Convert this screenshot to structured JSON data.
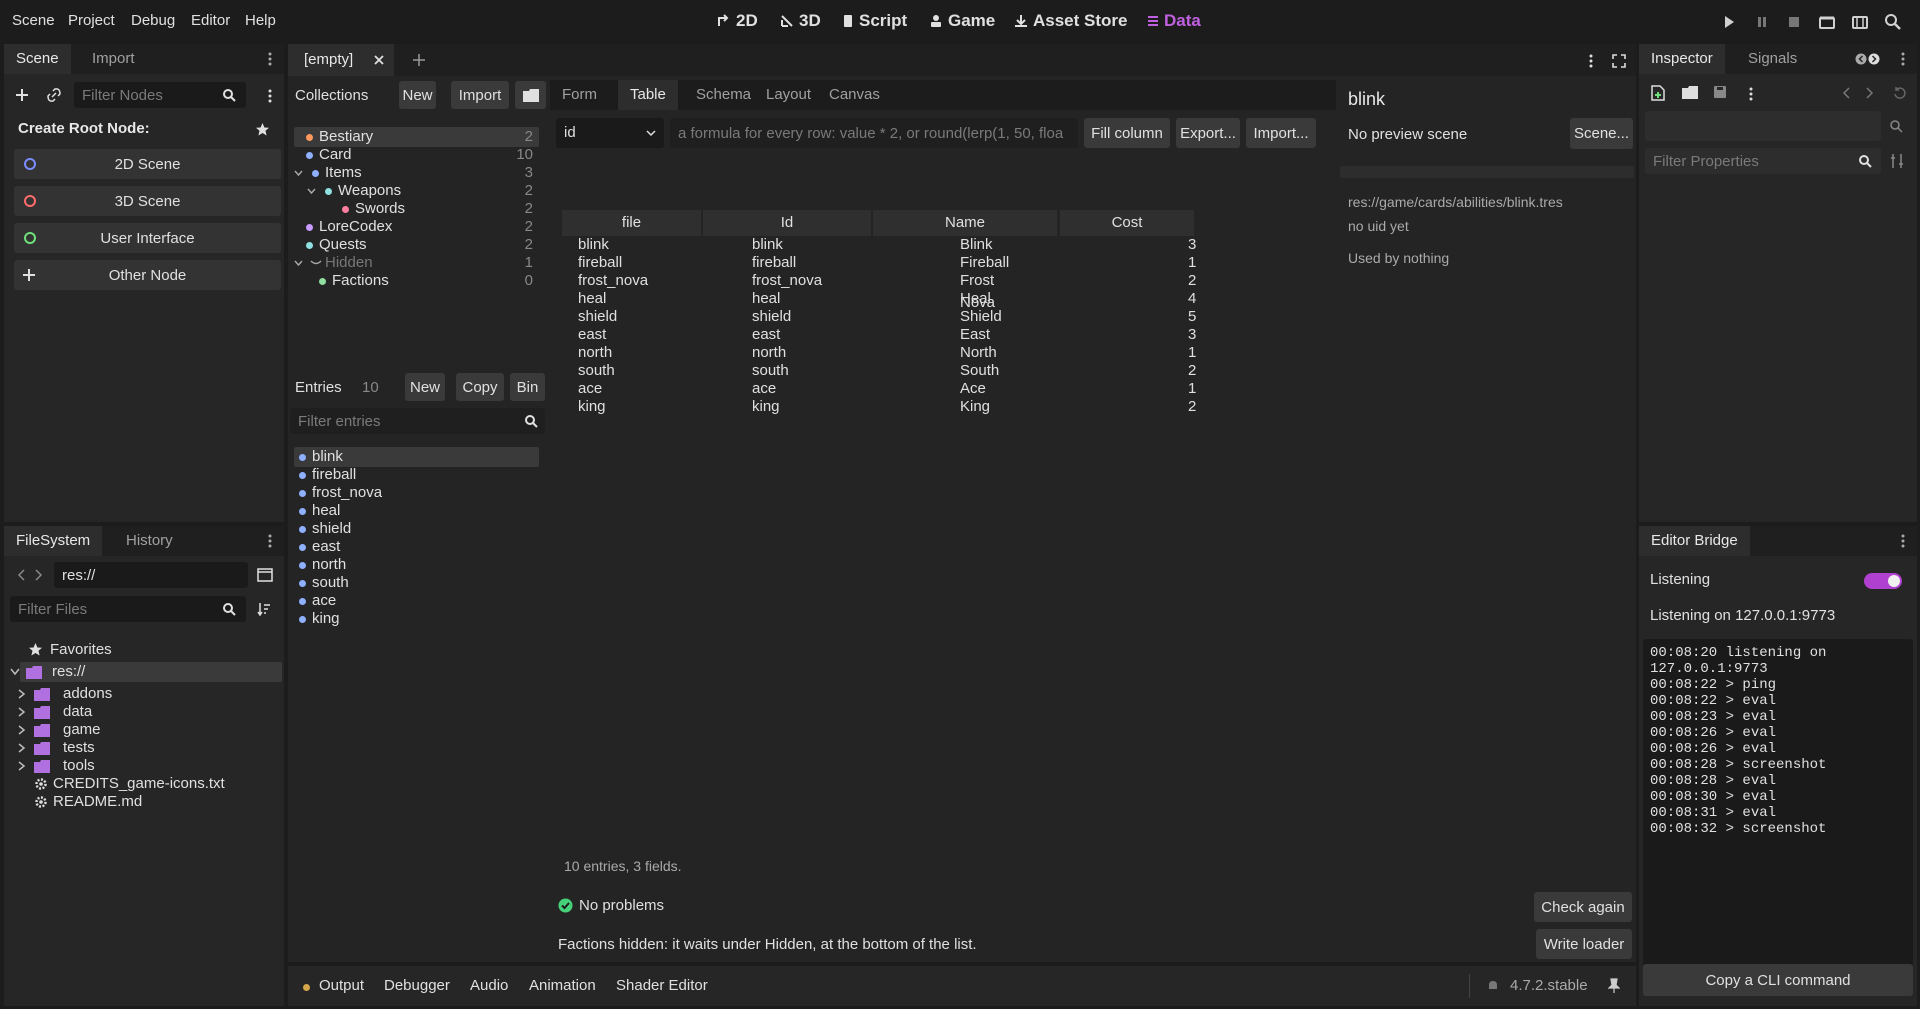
{
  "menu": [
    "Scene",
    "Project",
    "Debug",
    "Editor",
    "Help"
  ],
  "workspaces": [
    {
      "label": "2D",
      "icon": "2d-icon"
    },
    {
      "label": "3D",
      "icon": "3d-icon"
    },
    {
      "label": "Script",
      "icon": "script-icon"
    },
    {
      "label": "Game",
      "icon": "game-icon"
    },
    {
      "label": "Asset Store",
      "icon": "download-icon"
    },
    {
      "label": "Data",
      "icon": "list-icon",
      "active": true
    }
  ],
  "accent": "#c060e0",
  "scene_dock": {
    "tabs": [
      "Scene",
      "Import"
    ],
    "filter_placeholder": "Filter Nodes",
    "create_root_label": "Create Root Node:",
    "buttons": [
      {
        "label": "2D Scene",
        "color": "#7a8cff"
      },
      {
        "label": "3D Scene",
        "color": "#ff6b6b"
      },
      {
        "label": "User Interface",
        "color": "#6ee07a"
      },
      {
        "label": "Other Node",
        "color": "#e0e0e0"
      }
    ]
  },
  "filesystem": {
    "tabs": [
      "FileSystem",
      "History"
    ],
    "path": "res://",
    "filter_placeholder": "Filter Files",
    "favorites": "Favorites",
    "root": "res://",
    "folders": [
      "addons",
      "data",
      "game",
      "tests",
      "tools"
    ],
    "files": [
      "CREDITS_game-icons.txt",
      "README.md"
    ]
  },
  "editor_tab": {
    "label": "[empty]"
  },
  "collections": {
    "label": "Collections",
    "new": "New",
    "import": "Import",
    "items": [
      {
        "name": "Bestiary",
        "count": "2",
        "color": "#ff9a5c",
        "indent": 0,
        "selected": true
      },
      {
        "name": "Card",
        "count": "10",
        "color": "#8fb0ff",
        "indent": 0
      },
      {
        "name": "Items",
        "count": "3",
        "color": "#8fb0ff",
        "indent": 0,
        "expander": true
      },
      {
        "name": "Weapons",
        "count": "2",
        "color": "#8fe0e0",
        "indent": 1,
        "expander": true
      },
      {
        "name": "Swords",
        "count": "2",
        "color": "#ff7fa0",
        "indent": 2
      },
      {
        "name": "LoreCodex",
        "count": "2",
        "color": "#c79bff",
        "indent": 0
      },
      {
        "name": "Quests",
        "count": "2",
        "color": "#8fe0e0",
        "indent": 0
      },
      {
        "name": "Hidden",
        "count": "1",
        "color": "#888888",
        "indent": 0,
        "expander": true,
        "dim": true
      },
      {
        "name": "Factions",
        "count": "0",
        "color": "#8fe0a0",
        "indent": 1
      }
    ]
  },
  "entries": {
    "label": "Entries",
    "count": "10",
    "new": "New",
    "copy": "Copy",
    "bin": "Bin",
    "filter_placeholder": "Filter entries",
    "items": [
      "blink",
      "fireball",
      "frost_nova",
      "heal",
      "shield",
      "east",
      "north",
      "south",
      "ace",
      "king"
    ]
  },
  "view_tabs": [
    "Form",
    "Table",
    "Schema",
    "Layout",
    "Canvas"
  ],
  "active_view": "Table",
  "formula": {
    "column": "id",
    "placeholder": "a formula for every row: value * 2, or round(lerp(1, 50, floa",
    "fill": "Fill column",
    "export": "Export...",
    "import": "Import..."
  },
  "table": {
    "headers": [
      "file",
      "Id",
      "Name",
      "Cost"
    ],
    "rows": [
      [
        "blink",
        "blink",
        "Blink",
        "3"
      ],
      [
        "fireball",
        "fireball",
        "Fireball",
        "1"
      ],
      [
        "frost_nova",
        "frost_nova",
        "Frost Nova",
        "2"
      ],
      [
        "heal",
        "heal",
        "Heal",
        "4"
      ],
      [
        "shield",
        "shield",
        "Shield",
        "5"
      ],
      [
        "east",
        "east",
        "East",
        "3"
      ],
      [
        "north",
        "north",
        "North",
        "1"
      ],
      [
        "south",
        "south",
        "South",
        "2"
      ],
      [
        "ace",
        "ace",
        "Ace",
        "1"
      ],
      [
        "king",
        "king",
        "King",
        "2"
      ]
    ],
    "summary": "10 entries, 3 fields."
  },
  "status": {
    "problems": "No problems",
    "check_again": "Check again",
    "note": "Factions hidden: it waits under Hidden, at the bottom of the list.",
    "write_loader": "Write loader"
  },
  "preview": {
    "title": "blink",
    "no_preview": "No preview scene",
    "scene_button": "Scene...",
    "path": "res://game/cards/abilities/blink.tres",
    "uid": "no uid yet",
    "used_by": "Used by nothing"
  },
  "bottom_tabs": [
    "Output",
    "Debugger",
    "Audio",
    "Animation",
    "Shader Editor"
  ],
  "version": "4.7.2.stable",
  "inspector": {
    "tabs": [
      "Inspector",
      "Signals"
    ],
    "filter_placeholder": "Filter Properties"
  },
  "bridge": {
    "tab": "Editor Bridge",
    "listening_label": "Listening",
    "listening_on": "Listening on 127.0.0.1:9773",
    "log": [
      "00:08:20  listening on",
      "127.0.0.1:9773",
      "00:08:22  > ping",
      "00:08:22  > eval",
      "00:08:23  > eval",
      "00:08:26  > eval",
      "00:08:26  > eval",
      "00:08:28  > screenshot",
      "00:08:28  > eval",
      "00:08:30  > eval",
      "00:08:31  > eval",
      "00:08:32  > screenshot"
    ],
    "copy_cli": "Copy a CLI command"
  }
}
